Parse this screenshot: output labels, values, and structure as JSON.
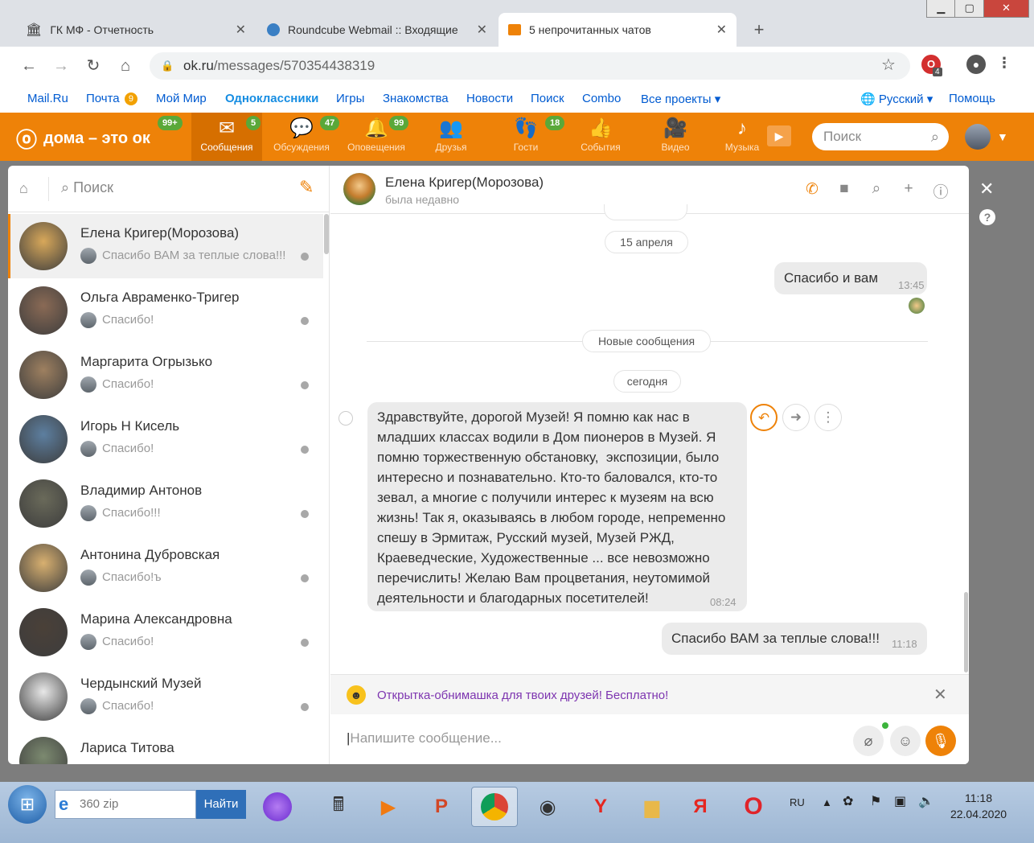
{
  "browser": {
    "tabs": [
      {
        "title": "ГК МФ - Отчетность",
        "icon": "bank-icon"
      },
      {
        "title": "Roundcube Webmail :: Входящие",
        "icon": "roundcube-icon"
      },
      {
        "title": "5 непрочитанных чатов",
        "icon": "ok-mail-icon"
      }
    ],
    "url_host": "ok.ru",
    "url_path": "/messages/570354438319",
    "extension_badge": "4"
  },
  "portal": {
    "links": [
      "Mail.Ru",
      "Почта",
      "Мой Мир",
      "Одноклассники",
      "Игры",
      "Знакомства",
      "Новости",
      "Поиск",
      "Combo",
      "Все проекты"
    ],
    "mail_count": "9",
    "language": "Русский",
    "help": "Помощь"
  },
  "ok": {
    "logo": "дома – это ок",
    "logo_badge": "99+",
    "nav": [
      {
        "label": "Сообщения",
        "badge": "5",
        "icon": "envelope-icon"
      },
      {
        "label": "Обсуждения",
        "badge": "47",
        "icon": "speech-bubbles-icon"
      },
      {
        "label": "Оповещения",
        "badge": "99",
        "icon": "bell-icon"
      },
      {
        "label": "Друзья",
        "badge": "",
        "icon": "friends-icon"
      },
      {
        "label": "Гости",
        "badge": "18",
        "icon": "footprints-icon"
      },
      {
        "label": "События",
        "badge": "",
        "icon": "events-icon"
      },
      {
        "label": "Видео",
        "badge": "",
        "icon": "video-camera-icon"
      },
      {
        "label": "Музыка",
        "badge": "",
        "icon": "music-note-icon"
      }
    ],
    "search_placeholder": "Поиск"
  },
  "sidebar": {
    "search_placeholder": "Поиск",
    "chats": [
      {
        "name": "Елена Кригер(Морозова)",
        "preview": "Спасибо ВАМ за теплые слова!!!",
        "color": "#d8a85a"
      },
      {
        "name": "Ольга Авраменко-Тригер",
        "preview": "Спасибо!",
        "color": "#8a6a55"
      },
      {
        "name": "Маргарита Огрызько",
        "preview": "Спасибо!",
        "color": "#9e8060"
      },
      {
        "name": "Игорь Н Кисель",
        "preview": "Спасибо!",
        "color": "#5d7fa0"
      },
      {
        "name": "Владимир Антонов",
        "preview": "Спасибо!!!",
        "color": "#6a6a5a"
      },
      {
        "name": "Антонина Дубровская",
        "preview": "Спасибо!ъ",
        "color": "#d8b070"
      },
      {
        "name": "Марина Александровна",
        "preview": "Спасибо!",
        "color": "#4a4038"
      },
      {
        "name": "Чердынский Музей",
        "preview": "Спасибо!",
        "color": "#e8e8e8"
      },
      {
        "name": "Лариса Титова",
        "preview": "",
        "color": "#7c8a70"
      }
    ]
  },
  "conversation": {
    "contact_name": "Елена Кригер(Морозова)",
    "contact_status": "была недавно",
    "date_1": "15 апреля",
    "msg_1": "Спасибо  и вам",
    "msg_1_time": "13:45",
    "new_messages": "Новые сообщения",
    "date_2": "сегодня",
    "msg_2_lines": [
      "Здравствуйте, дорогой Музей! Я помню как нас в",
      "младших классах водили в Дом пионеров в Музей. Я",
      "помню торжественную обстановку,  экспозиции, было",
      "интересно и познавательно. Кто-то баловался, кто-то",
      "зевал, а многие с получили интерес к музеям на всю",
      "жизнь! Так я, оказываясь в любом городе, непременно",
      "спешу в Эрмитаж, Русский музей, Музей РЖД,",
      "Краеведческие, Художественные ... все невозможно",
      "перечислить! Желаю Вам процветания, неутомимой",
      "деятельности и благодарных посетителей!"
    ],
    "msg_2_time": "08:24",
    "msg_3": "Спасибо ВАМ за теплые слова!!!",
    "msg_3_time": "11:18",
    "promo": "Открытка-обнимашка для твоих друзей! Бесплатно!",
    "input_placeholder": "Напишите сообщение..."
  },
  "taskbar": {
    "search_value": "360 zip",
    "find_button": "Найти",
    "lang": "RU",
    "time": "11:18",
    "date": "22.04.2020"
  }
}
